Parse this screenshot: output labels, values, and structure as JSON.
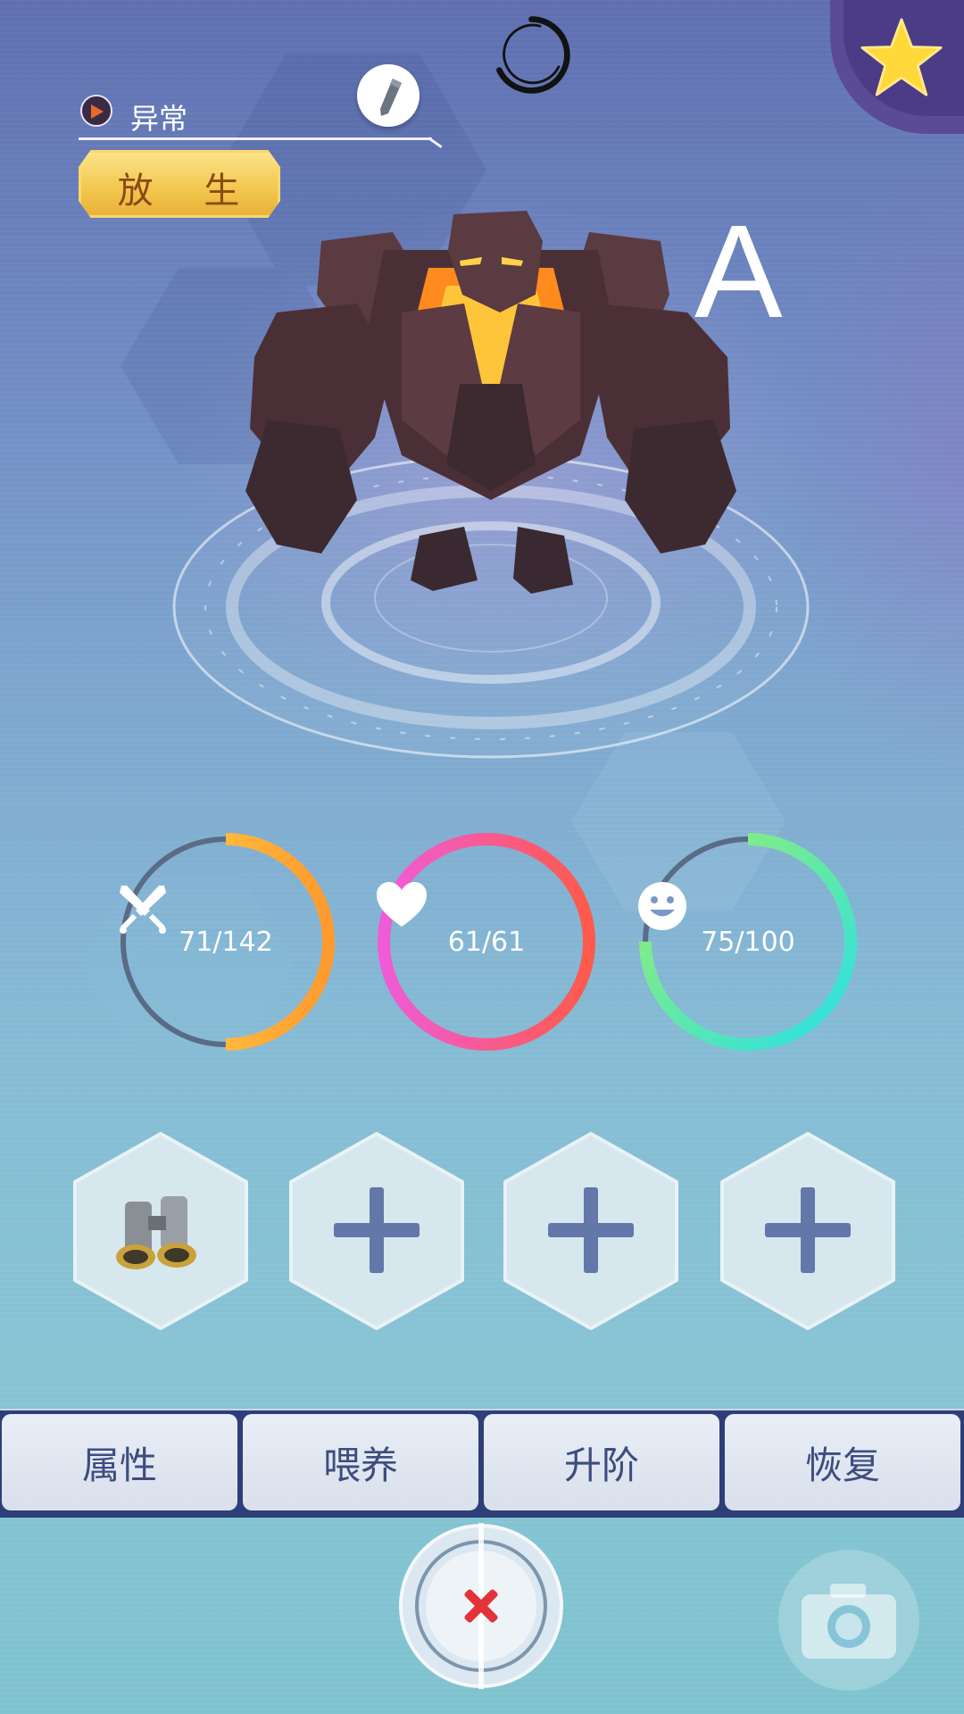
{
  "header": {
    "status_text": "异常",
    "release_label": "放 生",
    "rank": "A"
  },
  "icons": {
    "corner": "star-icon",
    "top_center": "loading-icon",
    "status": "status-fire-icon",
    "edit": "pencil-icon",
    "close": "close-icon",
    "camera": "camera-icon"
  },
  "stats": [
    {
      "name": "attack",
      "icon": "crossed-swords-icon",
      "value": "71/142",
      "fraction": 0.5,
      "colors": [
        "#ffd64a",
        "#ff9a2e"
      ]
    },
    {
      "name": "health",
      "icon": "heart-icon",
      "value": "61/61",
      "fraction": 1.0,
      "colors": [
        "#f05bd8",
        "#ff5a4a"
      ]
    },
    {
      "name": "mood",
      "icon": "smile-icon",
      "value": "75/100",
      "fraction": 0.75,
      "colors": [
        "#9cf06a",
        "#27e0e8"
      ]
    }
  ],
  "slots": [
    {
      "content": "binoculars-icon"
    },
    {
      "content": "plus-icon"
    },
    {
      "content": "plus-icon"
    },
    {
      "content": "plus-icon"
    }
  ],
  "tabs": [
    "属性",
    "喂养",
    "升阶",
    "恢复"
  ]
}
